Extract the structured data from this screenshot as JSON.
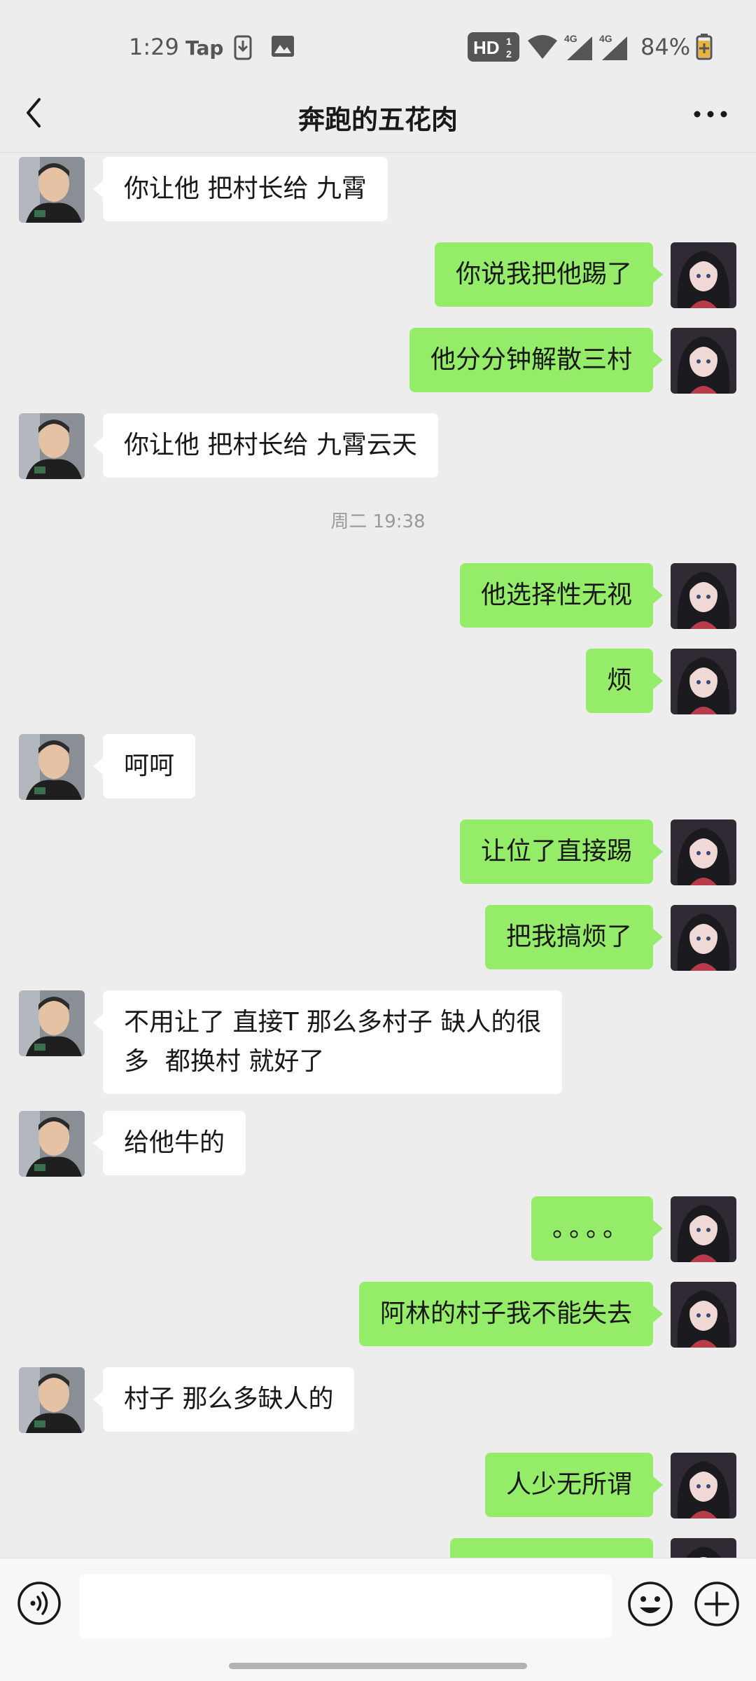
{
  "status_bar": {
    "time": "1:29",
    "app_label": "Tap",
    "network": "4G",
    "battery": "84%"
  },
  "header": {
    "title": "奔跑的五花肉",
    "back_icon": "chevron-left-icon",
    "more_icon": "more-dots-icon"
  },
  "messages": [
    {
      "side": "in",
      "text": "你让他 把村长给 九霄"
    },
    {
      "side": "out",
      "text": "你说我把他踢了"
    },
    {
      "side": "out",
      "text": "他分分钟解散三村"
    },
    {
      "side": "in",
      "text": "你让他 把村长给 九霄云天"
    },
    {
      "side": "time",
      "text": "周二 19:38"
    },
    {
      "side": "out",
      "text": "他选择性无视"
    },
    {
      "side": "out",
      "text": "烦"
    },
    {
      "side": "in",
      "text": "呵呵"
    },
    {
      "side": "out",
      "text": "让位了直接踢"
    },
    {
      "side": "out",
      "text": "把我搞烦了"
    },
    {
      "side": "in",
      "text": "不用让了 直接T 那么多村子 缺人的很\n多  都换村 就好了"
    },
    {
      "side": "in",
      "text": "给他牛的"
    },
    {
      "side": "out",
      "text": "。。。。"
    },
    {
      "side": "out",
      "text": "阿林的村子我不能失去"
    },
    {
      "side": "in",
      "text": "村子 那么多缺人的"
    },
    {
      "side": "out",
      "text": "人少无所谓"
    },
    {
      "side": "out",
      "text": ""
    }
  ],
  "input_bar": {
    "voice_icon": "voice-icon",
    "emoji_icon": "emoji-icon",
    "plus_icon": "plus-icon"
  },
  "colors": {
    "background": "#ededed",
    "outgoing_bubble": "#95ec69",
    "incoming_bubble": "#ffffff"
  }
}
